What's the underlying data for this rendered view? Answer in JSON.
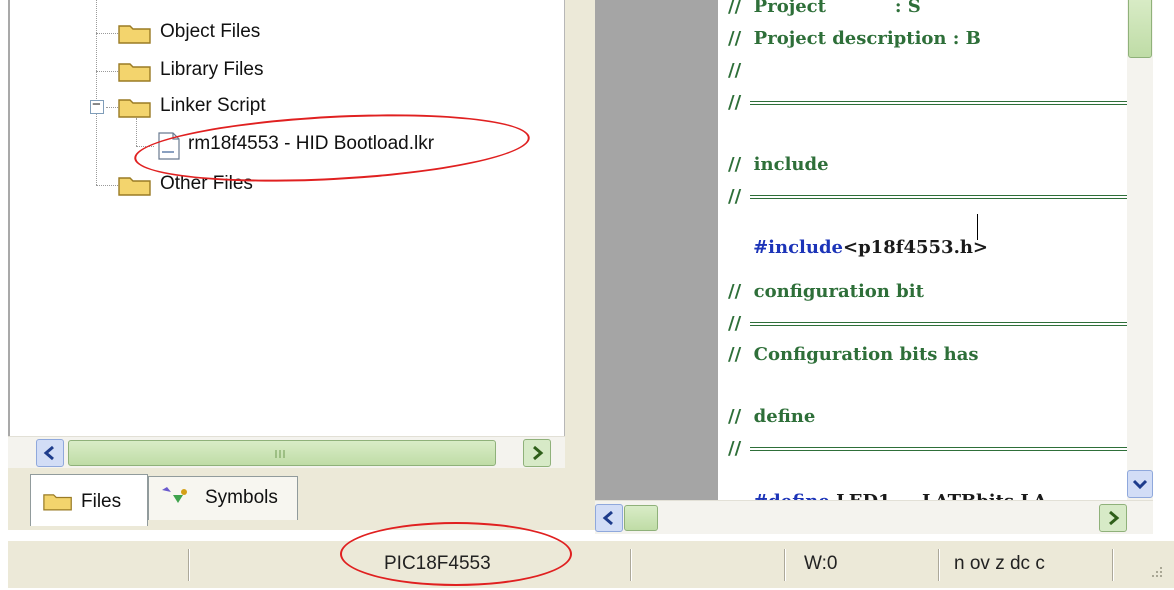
{
  "project_tree": {
    "items": [
      {
        "label": "Object Files",
        "kind": "folder"
      },
      {
        "label": "Library Files",
        "kind": "folder"
      },
      {
        "label": "Linker Script",
        "kind": "folder",
        "expanded": true,
        "toggle": "−"
      },
      {
        "label": "rm18f4553 - HID Bootload.lkr",
        "kind": "file"
      },
      {
        "label": "Other Files",
        "kind": "folder"
      }
    ]
  },
  "tabs": [
    {
      "label": "Files",
      "icon": "folder-icon",
      "active": true
    },
    {
      "label": "Symbols",
      "icon": "symbols-icon",
      "active": false
    }
  ],
  "editor": {
    "lines": [
      {
        "type": "comment",
        "text": "//  Project           : S"
      },
      {
        "type": "comment",
        "text": "//  Project description : B"
      },
      {
        "type": "comment",
        "text": "//"
      },
      {
        "type": "comment",
        "text": "//"
      },
      {
        "type": "blank",
        "text": ""
      },
      {
        "type": "comment",
        "text": "//  include"
      },
      {
        "type": "comment",
        "text": "//"
      },
      {
        "type": "code",
        "keyword": "#include",
        "rest": "<p18f4553.h>"
      },
      {
        "type": "blank",
        "text": ""
      },
      {
        "type": "comment",
        "text": "//  configuration bit"
      },
      {
        "type": "comment",
        "text": "//"
      },
      {
        "type": "comment",
        "text": "//  Configuration bits has "
      },
      {
        "type": "blank",
        "text": ""
      },
      {
        "type": "comment",
        "text": "//  define"
      },
      {
        "type": "comment",
        "text": "//"
      },
      {
        "type": "code",
        "keyword": "#define",
        "rest": " LED1     LATBbits.LA"
      }
    ]
  },
  "status_bar": {
    "device": "PIC18F4553",
    "wreg": "W:0",
    "flags": "n ov z dc c"
  },
  "colors": {
    "comment": "#2e6f39",
    "keyword": "#1c34b8",
    "annotation": "#e02020",
    "folder": "#f3d46d"
  }
}
